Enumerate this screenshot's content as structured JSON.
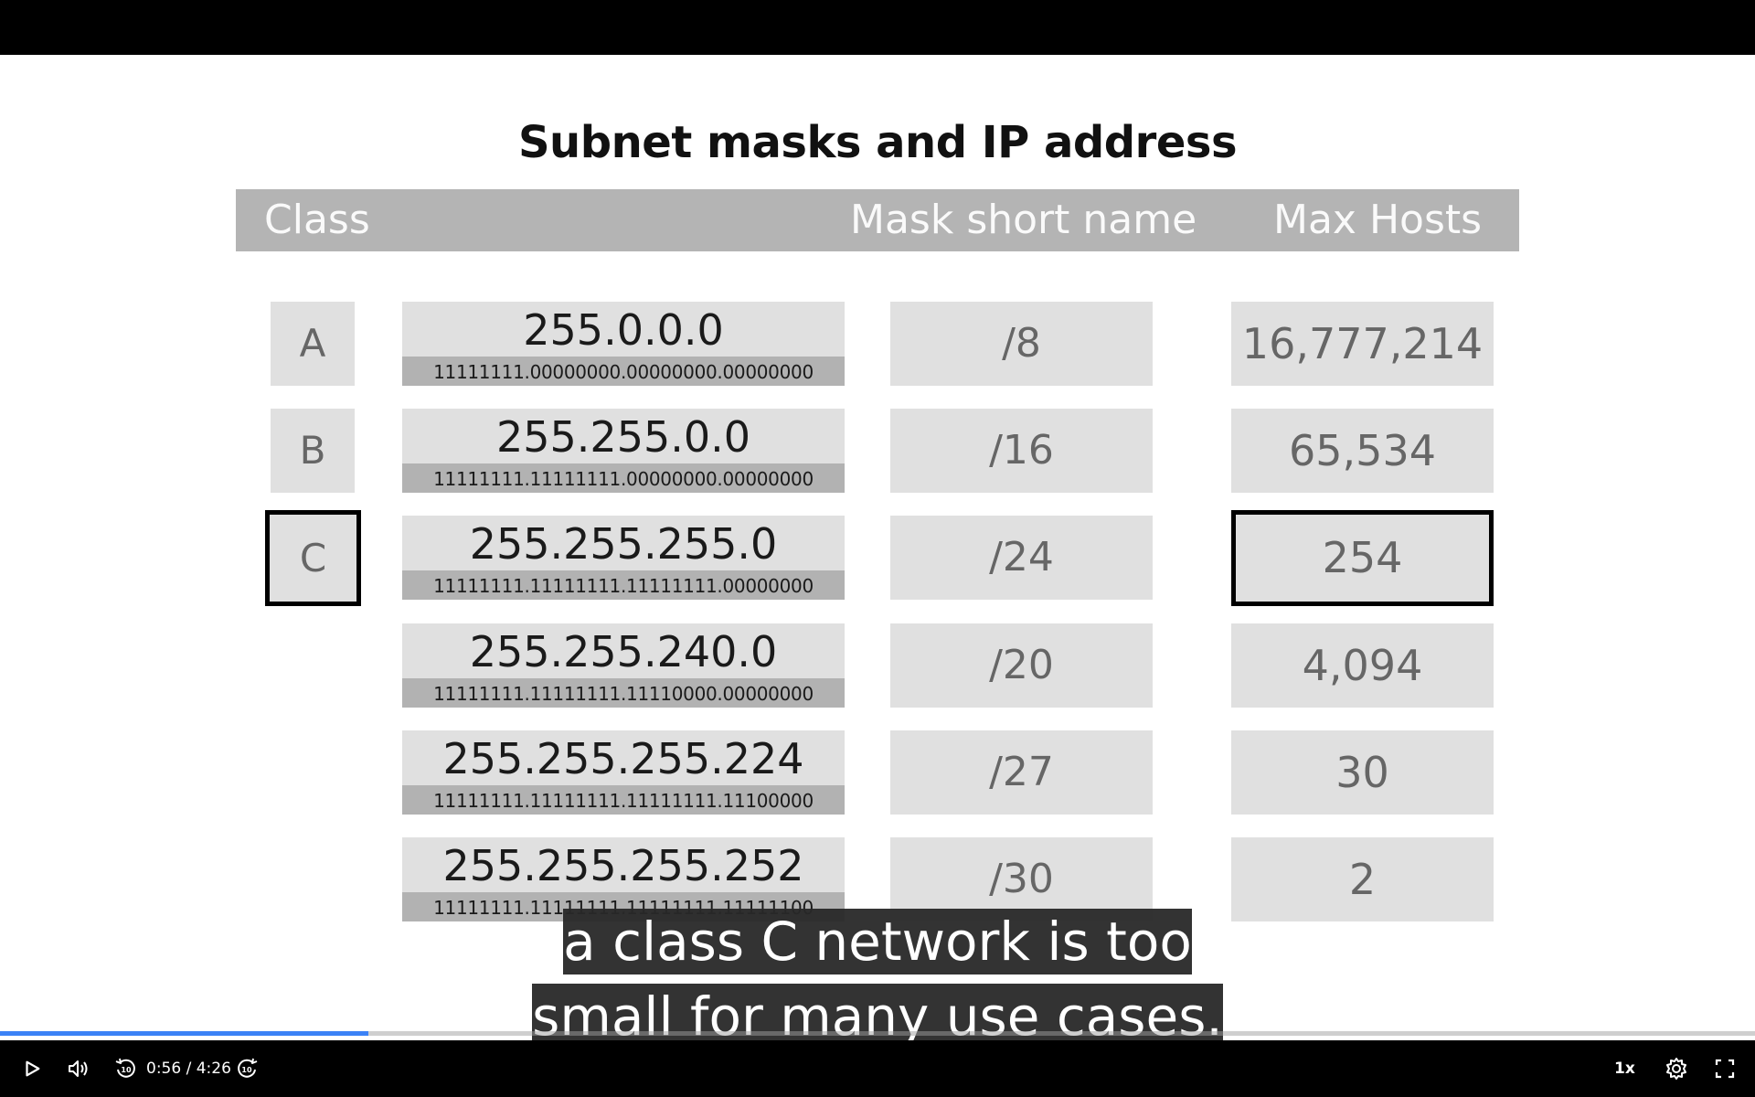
{
  "slide": {
    "title": "Subnet masks and IP address",
    "headers": {
      "class": "Class",
      "mask_short_name": "Mask short name",
      "max_hosts": "Max Hosts"
    },
    "rows": [
      {
        "class": "A",
        "mask": "255.0.0.0",
        "binary": "11111111.00000000.00000000.00000000",
        "short": "/8",
        "hosts": "16,777,214"
      },
      {
        "class": "B",
        "mask": "255.255.0.0",
        "binary": "11111111.11111111.00000000.00000000",
        "short": "/16",
        "hosts": "65,534"
      },
      {
        "class": "C",
        "mask": "255.255.255.0",
        "binary": "11111111.11111111.11111111.00000000",
        "short": "/24",
        "hosts": "254"
      },
      {
        "class": "",
        "mask": "255.255.240.0",
        "binary": "11111111.11111111.11110000.00000000",
        "short": "/20",
        "hosts": "4,094"
      },
      {
        "class": "",
        "mask": "255.255.255.224",
        "binary": "11111111.11111111.11111111.11100000",
        "short": "/27",
        "hosts": "30"
      },
      {
        "class": "",
        "mask": "255.255.255.252",
        "binary": "11111111.11111111.11111111.11111100",
        "short": "/30",
        "hosts": "2"
      }
    ],
    "highlighted_row_index": 2
  },
  "captions": {
    "line1": "a class C network is too",
    "line2": "small for many use cases."
  },
  "player": {
    "current_time": "0:56",
    "separator": "/",
    "duration": "4:26",
    "progress": 0.21,
    "speed": "1x",
    "accent_color": "#3b82f6",
    "icons": {
      "play": "play-icon",
      "volume": "volume-icon",
      "rewind": "rewind-10-icon",
      "forward": "forward-10-icon",
      "settings": "gear-icon",
      "fullscreen": "fullscreen-icon"
    }
  }
}
